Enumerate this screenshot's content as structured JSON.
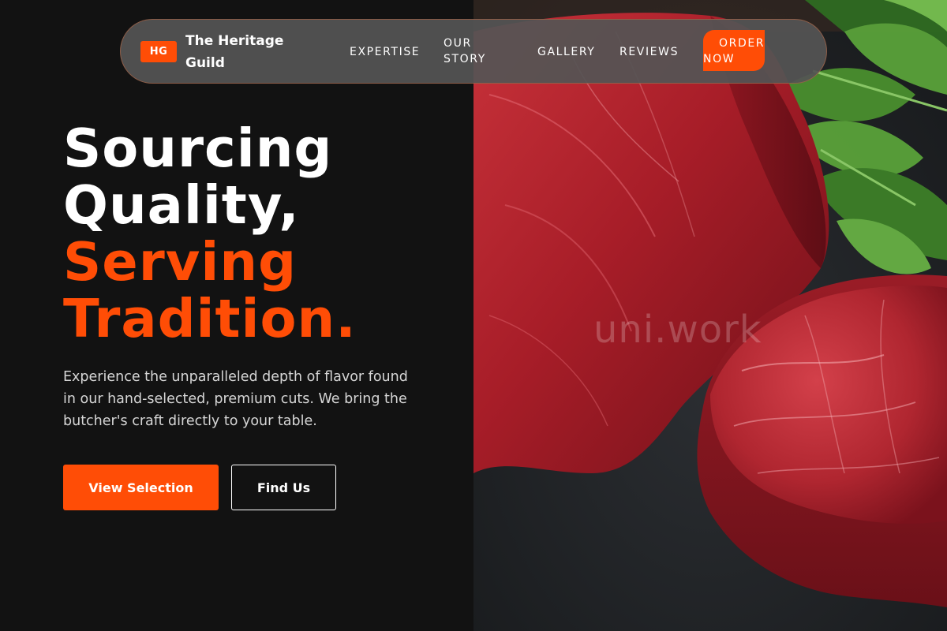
{
  "brand": {
    "badge": "HG",
    "name": "The Heritage Guild"
  },
  "nav": {
    "links": [
      "EXPERTISE",
      "OUR STORY",
      "GALLERY",
      "REVIEWS"
    ],
    "cta": "ORDER NOW"
  },
  "hero": {
    "title_line1": "Sourcing",
    "title_line2": "Quality,",
    "title_line3": "Serving",
    "title_line4": "Tradition.",
    "description": "Experience the unparalleled depth of flavor found in our hand-selected, premium cuts. We bring the butcher's craft directly to your table.",
    "primary_button": "View Selection",
    "secondary_button": "Find Us"
  },
  "photo": {
    "watermark": "uni.work",
    "alt": "raw-beef-cuts-image"
  },
  "colors": {
    "accent": "#ff4d06",
    "background": "#121212",
    "nav_bg": "#545454"
  }
}
